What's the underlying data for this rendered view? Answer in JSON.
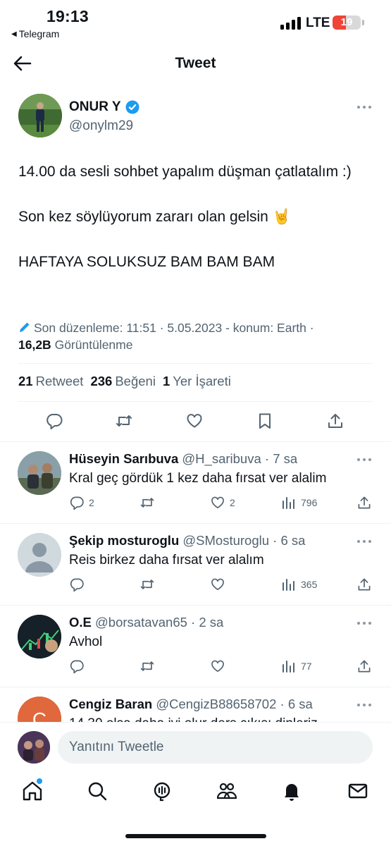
{
  "status_bar": {
    "time": "19:13",
    "back_app": "Telegram",
    "network": "LTE",
    "battery_level": "19",
    "battery_fraction": 0.19,
    "battery_color": "#ef4538"
  },
  "header": {
    "title": "Tweet",
    "back_icon": "arrow-left-icon"
  },
  "tweet": {
    "author_name": "ONUR Y",
    "verified_color": "#1d9bf0",
    "handle": "@onylm29",
    "lines": [
      "14.00 da sesli sohbet yapalım düşman çatlatalım :)",
      "Son kez söylüyorum zararı olan gelsin 🤘",
      "HAFTAYA SOLUKSUZ BAM BAM BAM"
    ],
    "edited_label": "Son düzenleme: 11:51 · 5.05.2023",
    "location": "- konum: Earth ·",
    "views_count": "16,2B",
    "views_label": "Görüntülenme",
    "retweets_count": "21",
    "retweets_label": "Retweet",
    "likes_count": "236",
    "likes_label": "Beğeni",
    "bookmarks_count": "1",
    "bookmarks_label": "Yer İşareti"
  },
  "replies": [
    {
      "name": "Hüseyin Sarıbuva",
      "handle_time": "@H_saribuva · 7 sa",
      "text": "Kral geç gördük 1 kez daha fırsat ver alalim",
      "replies": "2",
      "retweets": "",
      "likes": "2",
      "views": "796"
    },
    {
      "name": "Şekip mosturoglu",
      "handle_time": "@SMosturoglu · 6 sa",
      "text": "Reis birkez daha fırsat ver alalım",
      "replies": "",
      "retweets": "",
      "likes": "",
      "views": "365"
    },
    {
      "name": "O.E",
      "handle_time": "@borsatavan65 · 2 sa",
      "text": "Avhol",
      "replies": "",
      "retweets": "",
      "likes": "",
      "views": "77"
    },
    {
      "name": "Cengiz Baran",
      "handle_time": "@CengizB88658702 · 6 sa",
      "text": "14.30 olsa daha iyi olur ders çıkışı dinleriz"
    }
  ],
  "composer": {
    "placeholder": "Yanıtını Tweetle"
  },
  "tabbar": {
    "icons": [
      "home-icon",
      "search-icon",
      "spaces-icon",
      "communities-icon",
      "notifications-icon",
      "messages-icon"
    ]
  }
}
